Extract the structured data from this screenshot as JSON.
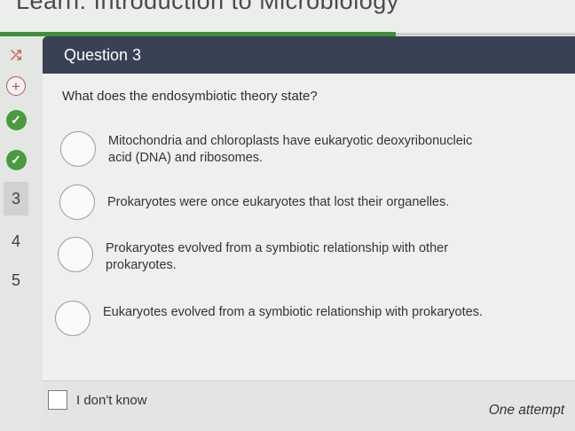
{
  "header": {
    "course_title": "Learn: Introduction to Microbiology"
  },
  "sidebar": {
    "items": [
      {
        "icon": "shuffle-icon",
        "glyph": "⤮"
      },
      {
        "icon": "plus-icon",
        "glyph": "+"
      },
      {
        "icon": "check-icon",
        "glyph": "✓"
      },
      {
        "icon": "check-icon",
        "glyph": "✓"
      },
      {
        "label": "3"
      },
      {
        "label": "4"
      },
      {
        "label": "5"
      }
    ]
  },
  "question": {
    "title": "Question 3",
    "prompt": "What does the endosymbiotic theory state?",
    "options": [
      "Mitochondria and chloroplasts have eukaryotic deoxyribonucleic acid (DNA) and ribosomes.",
      "Prokaryotes were once eukaryotes that lost their organelles.",
      "Prokaryotes evolved from a symbiotic relationship with other prokaryotes.",
      "Eukaryotes evolved from a symbiotic relationship with prokaryotes."
    ]
  },
  "footer": {
    "idk_label": "I don't know",
    "attempt_note": "One attempt"
  },
  "colors": {
    "header_bg": "#394255",
    "progress": "#3f8f3a",
    "check": "#4a9a40"
  }
}
